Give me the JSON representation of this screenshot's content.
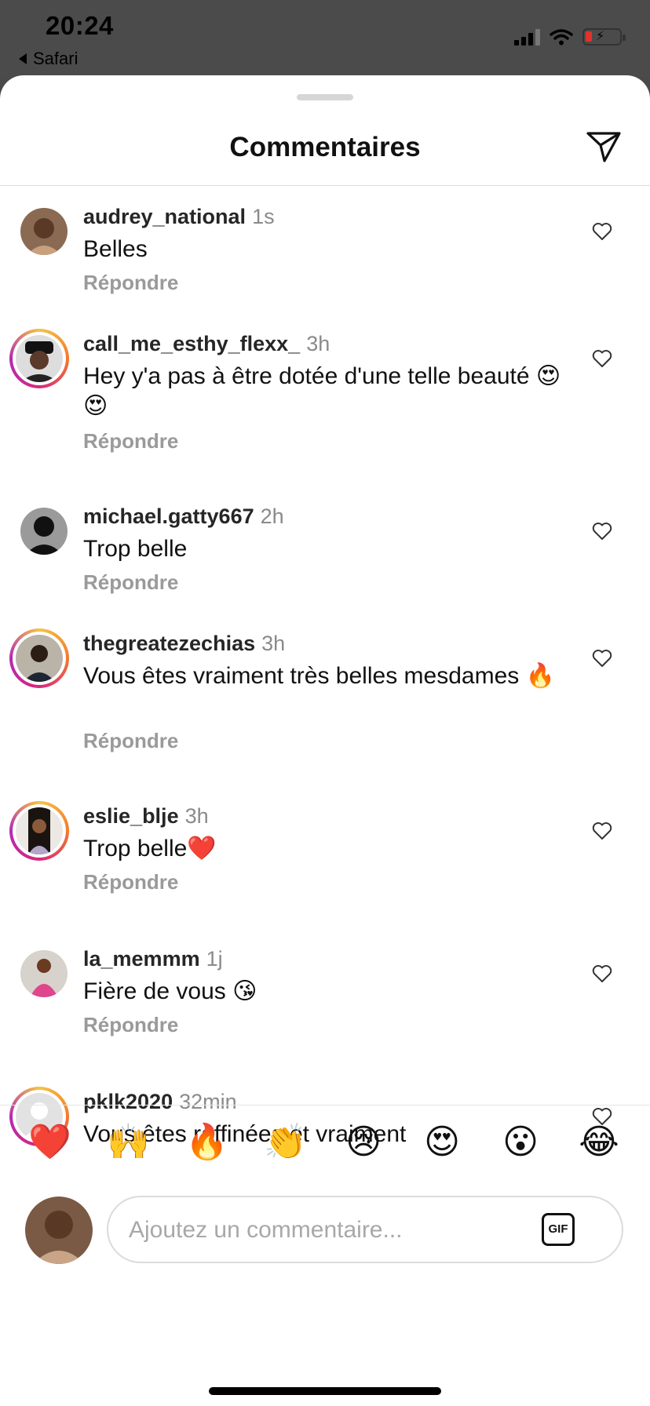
{
  "status_bar": {
    "time": "20:24",
    "back_app": "Safari"
  },
  "header": {
    "title": "Commentaires",
    "send_icon": "paper-plane-icon"
  },
  "reply_label": "Répondre",
  "comments": [
    {
      "user": "audrey_national",
      "ago": "1s",
      "text": "Belles",
      "ring": false
    },
    {
      "user": "call_me_esthy_flexx_",
      "ago": "3h",
      "text": "Hey y'a pas à être dotée d'une telle beauté 😍 😍",
      "ring": true
    },
    {
      "user": "michael.gatty667",
      "ago": "2h",
      "text": "Trop belle",
      "ring": false
    },
    {
      "user": "thegreatezechias",
      "ago": "3h",
      "text": "Vous êtes vraiment très belles mesdames 🔥",
      "ring": true
    },
    {
      "user": "eslie_blje",
      "ago": "3h",
      "text": "Trop belle❤️",
      "ring": true
    },
    {
      "user": "la_memmm",
      "ago": "1j",
      "text": "Fière de vous 😘",
      "ring": false
    },
    {
      "user": "pklk2020",
      "ago": "32min",
      "text": "Vous êtes raffinées et vraiment",
      "ring": true
    }
  ],
  "quick_reactions": [
    "❤️",
    "🙌",
    "🔥",
    "👏",
    "😢",
    "😍",
    "😮",
    "😂"
  ],
  "composer": {
    "placeholder": "Ajoutez un commentaire...",
    "gif_label": "GIF"
  },
  "colors": {
    "accent_ring": [
      "#f6c343",
      "#f27a2e",
      "#d8287c",
      "#b32ab5"
    ],
    "reply_gray": "#9a9a9a"
  }
}
